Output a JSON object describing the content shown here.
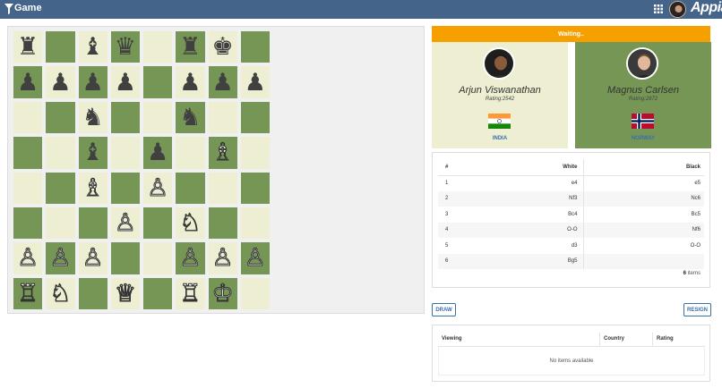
{
  "header": {
    "title": "Game",
    "brand": "Appian"
  },
  "board": {
    "rows": [
      [
        "r",
        "",
        "b",
        "q",
        "",
        "r",
        "k",
        ""
      ],
      [
        "p",
        "p",
        "p",
        "p",
        "",
        "p",
        "p",
        "p"
      ],
      [
        "",
        "",
        "n",
        "",
        "",
        "n",
        "",
        ""
      ],
      [
        "",
        "",
        "b",
        "",
        "p",
        "",
        "B",
        ""
      ],
      [
        "",
        "",
        "B",
        "",
        "P",
        "",
        "",
        ""
      ],
      [
        "",
        "",
        "",
        "P",
        "",
        "N",
        "",
        ""
      ],
      [
        "P",
        "P",
        "P",
        "",
        "",
        "P",
        "P",
        "P"
      ],
      [
        "R",
        "N",
        "",
        "Q",
        "",
        "R",
        "K",
        ""
      ]
    ],
    "glyphs": {
      "K": "♔",
      "Q": "♕",
      "R": "♖",
      "B": "♗",
      "N": "♘",
      "P": "♙",
      "k": "♚",
      "q": "♛",
      "r": "♜",
      "b": "♝",
      "n": "♞",
      "p": "♟"
    },
    "light_color": "#eeeed2",
    "dark_color": "#769656"
  },
  "status": {
    "text": "Waiting.."
  },
  "white_player": {
    "name": "Arjun Viswanathan",
    "rating": "Rating:2542",
    "country": "INDIA",
    "flag_icon": "india-flag-icon"
  },
  "black_player": {
    "name": "Magnus Carlsen",
    "rating": "Rating:2872",
    "country": "NORWAY",
    "flag_icon": "norway-flag-icon"
  },
  "moves": {
    "headers": {
      "num": "#",
      "white": "White",
      "black": "Black"
    },
    "rows": [
      {
        "num": "1",
        "white": "e4",
        "black": "e5"
      },
      {
        "num": "2",
        "white": "Nf3",
        "black": "Nc6"
      },
      {
        "num": "3",
        "white": "Bc4",
        "black": "Bc5"
      },
      {
        "num": "4",
        "white": "O-O",
        "black": "Nf6"
      },
      {
        "num": "5",
        "white": "d3",
        "black": "O-O"
      },
      {
        "num": "6",
        "white": "Bg5",
        "black": ""
      }
    ],
    "count": "6",
    "count_label": " items"
  },
  "actions": {
    "draw": "DRAW",
    "resign": "RESIGN"
  },
  "viewing": {
    "headers": {
      "viewing": "Viewing",
      "country": "Country",
      "rating": "Rating"
    },
    "empty_text": "No items available"
  }
}
